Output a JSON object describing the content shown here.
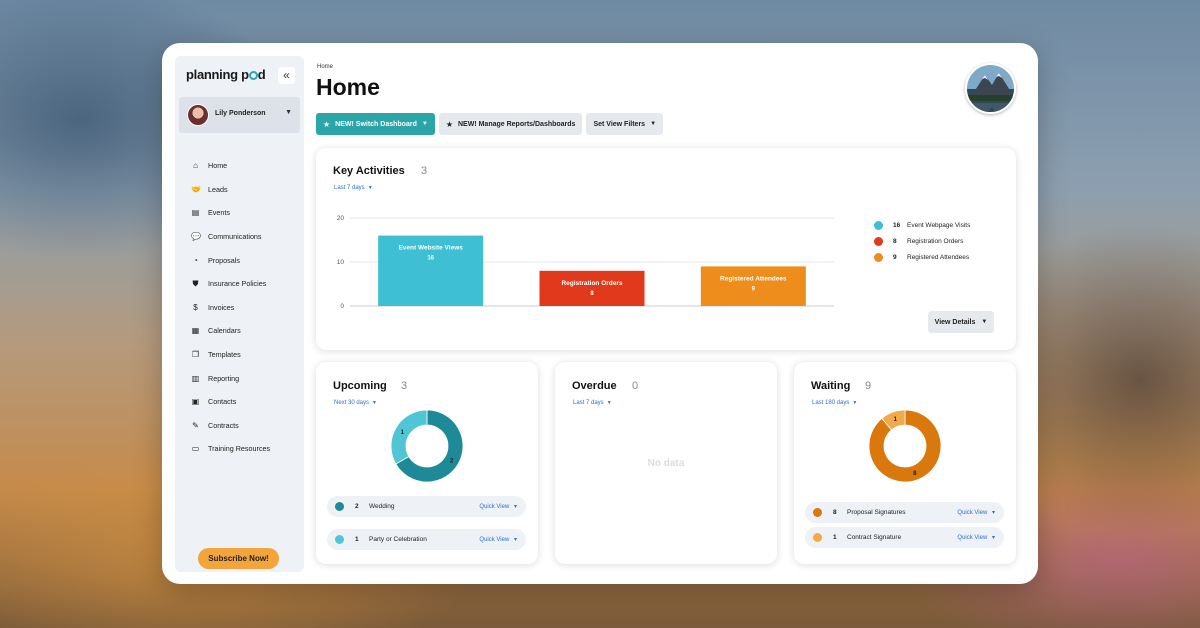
{
  "colors": {
    "teal": "#3ebfd4",
    "red": "#e0391c",
    "orange": "#ee8c1c",
    "dark_teal": "#1e8a98",
    "light_teal": "#4fc5d6",
    "brown_orange": "#d9780c",
    "light_orange": "#f3a849",
    "primary_button": "#2aa6a8",
    "subscribe": "#f3a43b"
  },
  "logo": {
    "text_a": "planning p",
    "text_b": "d"
  },
  "user": {
    "name": "Lily Ponderson"
  },
  "nav": [
    {
      "label": "Home",
      "icon": "home-icon",
      "glyph": "⌂"
    },
    {
      "label": "Leads",
      "icon": "handshake-icon",
      "glyph": "🤝"
    },
    {
      "label": "Events",
      "icon": "book-icon",
      "glyph": "▤"
    },
    {
      "label": "Communications",
      "icon": "chat-icon",
      "glyph": "💬"
    },
    {
      "label": "Proposals",
      "icon": "pie-chart-icon",
      "glyph": "◔"
    },
    {
      "label": "Insurance Policies",
      "icon": "shield-icon",
      "glyph": "⛊"
    },
    {
      "label": "Invoices",
      "icon": "dollar-icon",
      "glyph": "$"
    },
    {
      "label": "Calendars",
      "icon": "calendar-icon",
      "glyph": "▦"
    },
    {
      "label": "Templates",
      "icon": "copy-icon",
      "glyph": "❐"
    },
    {
      "label": "Reporting",
      "icon": "report-icon",
      "glyph": "▥"
    },
    {
      "label": "Contacts",
      "icon": "contact-card-icon",
      "glyph": "▣"
    },
    {
      "label": "Contracts",
      "icon": "signature-icon",
      "glyph": "✎"
    },
    {
      "label": "Training Resources",
      "icon": "presentation-icon",
      "glyph": "▭"
    }
  ],
  "subscribe_label": "Subscribe Now!",
  "header": {
    "breadcrumb": "Home",
    "title": "Home"
  },
  "toolbar": {
    "switch_dashboard": "NEW! Switch Dashboard",
    "manage_reports": "NEW! Manage Reports/Dashboards",
    "view_filters": "Set View Filters"
  },
  "key_activities": {
    "title": "Key Activities",
    "count": "3",
    "period": "Last 7 days",
    "legend": [
      {
        "count": "16",
        "label": "Event Webpage Visits",
        "color": "#3ebfd4"
      },
      {
        "count": "8",
        "label": "Registration Orders",
        "color": "#e0391c"
      },
      {
        "count": "9",
        "label": "Registered Attendees",
        "color": "#ee8c1c"
      }
    ],
    "view_details": "View Details"
  },
  "chart_data": {
    "type": "bar",
    "title": "Key Activities",
    "categories": [
      "Event Website Views",
      "Registration Orders",
      "Registered Attendees"
    ],
    "values": [
      16,
      8,
      9
    ],
    "colors": [
      "#3ebfd4",
      "#e0391c",
      "#ee8c1c"
    ],
    "yticks": [
      0,
      10,
      20
    ],
    "ylim": [
      0,
      20
    ],
    "grid": true,
    "xlabel": "",
    "ylabel": ""
  },
  "upcoming": {
    "title": "Upcoming",
    "count": "3",
    "period": "Next 30 days",
    "slices": [
      {
        "value": 2,
        "label": "2",
        "color": "#1e8a98"
      },
      {
        "value": 1,
        "label": "1",
        "color": "#4fc5d6"
      }
    ],
    "items": [
      {
        "count": "2",
        "label": "Wedding",
        "color": "#1e8a98",
        "action": "Quick View"
      },
      {
        "count": "1",
        "label": "Party or Celebration",
        "color": "#4fc5d6",
        "action": "Quick View"
      }
    ]
  },
  "overdue": {
    "title": "Overdue",
    "count": "0",
    "period": "Last 7 days",
    "empty": "No data"
  },
  "waiting": {
    "title": "Waiting",
    "count": "9",
    "period": "Last 180 days",
    "slices": [
      {
        "value": 8,
        "label": "8",
        "color": "#d9780c"
      },
      {
        "value": 1,
        "label": "1",
        "color": "#f3a849"
      }
    ],
    "items": [
      {
        "count": "8",
        "label": "Proposal Signatures",
        "color": "#d9780c",
        "action": "Quick View"
      },
      {
        "count": "1",
        "label": "Contract Signature",
        "color": "#f3a849",
        "action": "Quick View"
      }
    ]
  }
}
